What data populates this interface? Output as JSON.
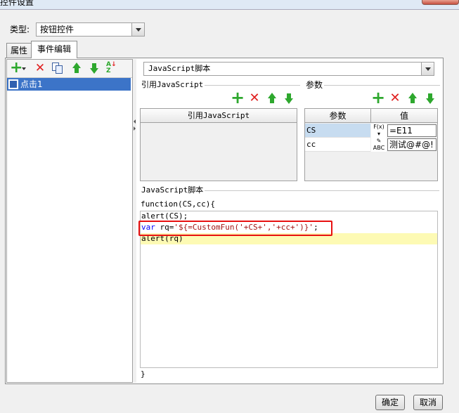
{
  "window": {
    "title": "控件设置"
  },
  "type_row": {
    "label": "类型:",
    "value": "按钮控件"
  },
  "tabs": [
    {
      "label": "属性"
    },
    {
      "label": "事件编辑"
    }
  ],
  "events": [
    {
      "label": "点击1",
      "selected": true
    }
  ],
  "script_type": {
    "value": "JavaScript脚本"
  },
  "ref_js": {
    "group_title": "引用JavaScript",
    "column_header": "引用JavaScript"
  },
  "params": {
    "group_title": "参数",
    "columns": [
      "参数",
      "值"
    ],
    "rows": [
      {
        "name": "CS",
        "type_icon": "formula-icon",
        "type_text": "F(x)",
        "value": "=E11",
        "selected": true
      },
      {
        "name": "cc",
        "type_icon": "text-type-icon",
        "type_text": "ABC",
        "value": "测试@#@!",
        "selected": false
      }
    ]
  },
  "script": {
    "group_title": "JavaScript脚本",
    "header_line": "function(CS,cc){",
    "lines": {
      "l1": "alert(CS);",
      "l2_kw": "var",
      "l2_mid": " rq=",
      "l2_str": "'${=CustomFun('+CS+','+cc+')}'",
      "l2_end": ";",
      "l3": "alert(rq)"
    },
    "footer_line": "}",
    "highlight_color": "#fdfab4",
    "annotation_color": "#e81010"
  },
  "buttons": {
    "ok": "确定",
    "cancel": "取消"
  },
  "icons": [
    "add-icon",
    "delete-icon",
    "copy-icon",
    "move-up-icon",
    "move-down-icon",
    "sort-icon"
  ]
}
